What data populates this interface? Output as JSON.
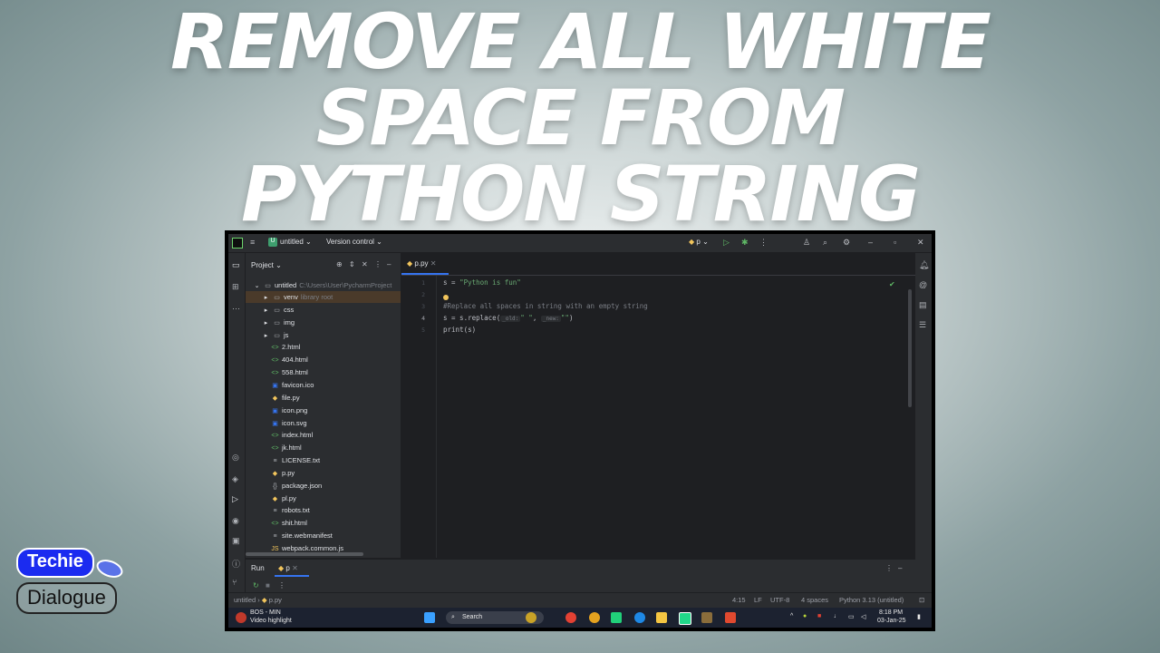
{
  "headline": {
    "line1": "REMOVE ALL WHITE",
    "line2": "SPACE FROM",
    "line3": "PYTHON STRING"
  },
  "brand": {
    "line1": "Techie",
    "line2": "Dialogue"
  },
  "ide": {
    "titlebar": {
      "project_badge": "U",
      "project": "untitled",
      "vcs": "Version control",
      "run_config": "p"
    },
    "project_panel": {
      "title": "Project",
      "root": {
        "name": "untitled",
        "path": "C:\\Users\\User\\PycharmProject"
      },
      "items": [
        {
          "icon": "folder-icon",
          "glyph": "▸",
          "name": "venv",
          "dim": "library root"
        },
        {
          "icon": "folder-icon",
          "glyph": "▸",
          "name": "css"
        },
        {
          "icon": "folder-icon",
          "glyph": "▸",
          "name": "img"
        },
        {
          "icon": "folder-icon",
          "glyph": "▸",
          "name": "js"
        },
        {
          "icon": "html-icon",
          "name": "2.html"
        },
        {
          "icon": "html-icon",
          "name": "404.html"
        },
        {
          "icon": "html-icon",
          "name": "558.html"
        },
        {
          "icon": "image-icon",
          "name": "favicon.ico"
        },
        {
          "icon": "python-icon",
          "name": "file.py"
        },
        {
          "icon": "image-icon",
          "name": "icon.png"
        },
        {
          "icon": "image-icon",
          "name": "icon.svg"
        },
        {
          "icon": "html-icon",
          "name": "index.html"
        },
        {
          "icon": "html-icon",
          "name": "jk.html"
        },
        {
          "icon": "text-icon",
          "name": "LICENSE.txt"
        },
        {
          "icon": "python-icon",
          "name": "p.py"
        },
        {
          "icon": "json-icon",
          "name": "package.json"
        },
        {
          "icon": "python-icon",
          "name": "pl.py"
        },
        {
          "icon": "text-icon",
          "name": "robots.txt"
        },
        {
          "icon": "html-icon",
          "name": "shit.html"
        },
        {
          "icon": "text-icon",
          "name": "site.webmanifest"
        },
        {
          "icon": "js-icon",
          "name": "webpack.common.js"
        }
      ]
    },
    "editor": {
      "tab": "p.py",
      "lines": [
        "1",
        "2",
        "3",
        "4",
        "5"
      ],
      "code": {
        "l1_a": "s = ",
        "l1_str": "\"Python is fun\"",
        "l3": "#Replace all spaces in string with an empty string",
        "l4_a": "s = s.replace(",
        "l4_h1": "_old:",
        "l4_s1": "\" \"",
        "l4_c": ",",
        "l4_h2": "_new:",
        "l4_s2": "\"\"",
        "l4_e": ")",
        "l5": "print(s)"
      }
    },
    "run_panel": {
      "title": "Run",
      "tab": "p"
    },
    "status": {
      "breadcrumb_project": "untitled",
      "breadcrumb_file": "p.py",
      "position": "4:15",
      "line_sep": "LF",
      "encoding": "UTF-8",
      "indent": "4 spaces",
      "interpreter": "Python 3.13 (untitled)"
    },
    "taskbar": {
      "notif_title": "BOS - MIN",
      "notif_sub": "Video highlight",
      "search": "Search",
      "time": "8:18 PM",
      "date": "03-Jan-25"
    }
  }
}
